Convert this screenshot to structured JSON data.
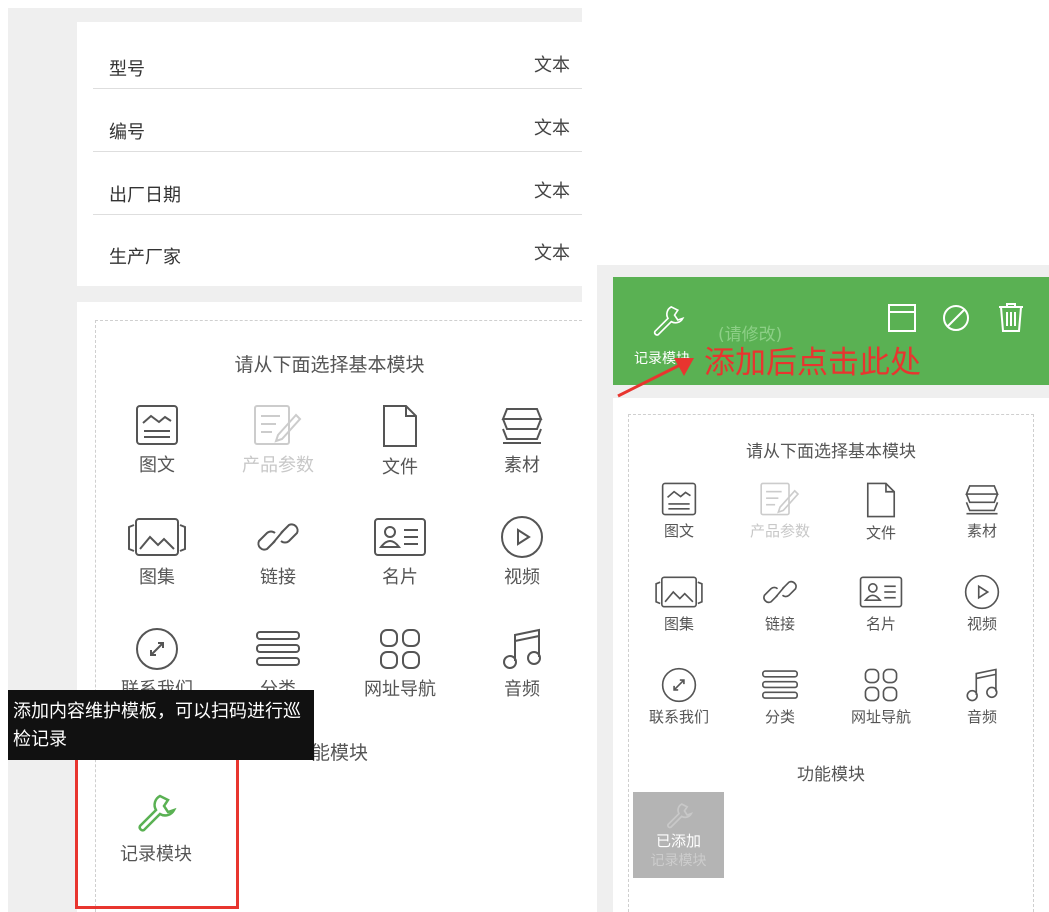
{
  "table": {
    "rows": [
      {
        "label": "型号",
        "value": "文本"
      },
      {
        "label": "编号",
        "value": "文本"
      },
      {
        "label": "出厂日期",
        "value": "文本"
      },
      {
        "label": "生产厂家",
        "value": "文本"
      }
    ]
  },
  "left": {
    "basic_title": "请从下面选择基本模块",
    "modules": [
      {
        "label": "图文",
        "icon": "image-text-icon"
      },
      {
        "label": "产品参数",
        "icon": "product-params-icon",
        "disabled": true
      },
      {
        "label": "文件",
        "icon": "file-icon"
      },
      {
        "label": "素材",
        "icon": "material-icon"
      },
      {
        "label": "图集",
        "icon": "gallery-icon"
      },
      {
        "label": "链接",
        "icon": "link-icon"
      },
      {
        "label": "名片",
        "icon": "business-card-icon"
      },
      {
        "label": "视频",
        "icon": "video-icon"
      },
      {
        "label": "联系我们",
        "icon": "contact-icon"
      },
      {
        "label": "分类",
        "icon": "category-icon"
      },
      {
        "label": "网址导航",
        "icon": "url-nav-icon"
      },
      {
        "label": "音频",
        "icon": "audio-icon"
      }
    ],
    "func_title": "能模块",
    "record_label": "记录模块",
    "tooltip": "添加内容维护模板，可以扫码进行巡检记录"
  },
  "right": {
    "header_label": "记录模块",
    "header_ghost": "(请修改)",
    "annotation": "添加后点击此处",
    "basic_title": "请从下面选择基本模块",
    "func_title": "功能模块",
    "added_label": "已添加",
    "added_sub": "记录模块"
  },
  "colors": {
    "green": "#5ab153",
    "red": "#e8352f"
  }
}
